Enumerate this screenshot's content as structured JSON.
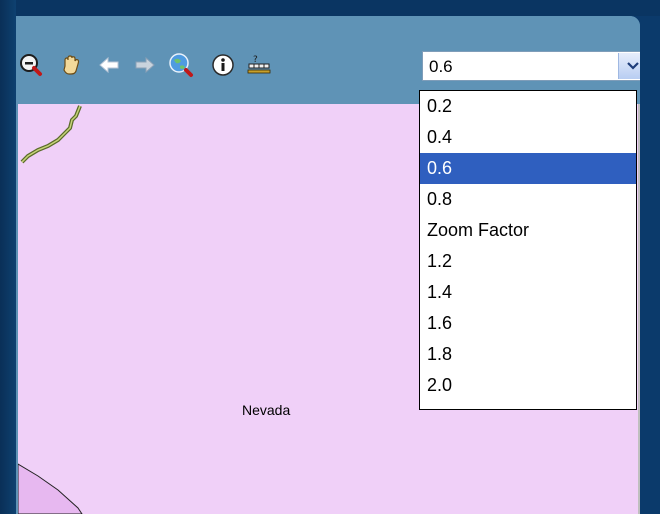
{
  "toolbar": {
    "icons": [
      "zoom-out-icon",
      "pan-hand-icon",
      "back-arrow-icon",
      "forward-arrow-icon",
      "globe-zoom-icon",
      "info-icon",
      "scale-icon"
    ]
  },
  "zoom_select": {
    "value": "0.6",
    "options": [
      "0.2",
      "0.4",
      "0.6",
      "0.8",
      "Zoom Factor",
      "1.2",
      "1.4",
      "1.6",
      "1.8",
      "2.0"
    ],
    "selected_index": 2
  },
  "map": {
    "region_label": "Nevada",
    "fill_color": "#f0d0f8"
  },
  "colors": {
    "toolbar": "#5f93b6",
    "background": "#0b3a6b",
    "selection": "#2f5fbf"
  }
}
